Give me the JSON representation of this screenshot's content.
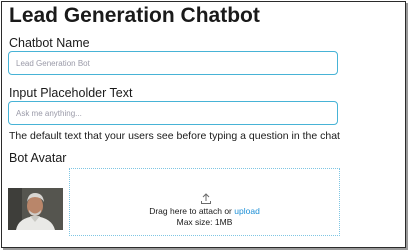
{
  "page": {
    "title": "Lead Generation Chatbot"
  },
  "chatbot_name": {
    "label": "Chatbot Name",
    "placeholder": "Lead Generation Bot"
  },
  "input_placeholder": {
    "label": "Input Placeholder Text",
    "placeholder": "Ask me anything...",
    "help": "The default text that your users see before typing a question in the chat"
  },
  "bot_avatar": {
    "label": "Bot Avatar",
    "dropzone": {
      "icon": "upload-icon",
      "prefix": "Drag here to attach or",
      "link": "upload",
      "max_size": "Max size: 1MB"
    }
  },
  "colors": {
    "accent": "#1c8fd6",
    "field_border": "#47b3d6"
  }
}
